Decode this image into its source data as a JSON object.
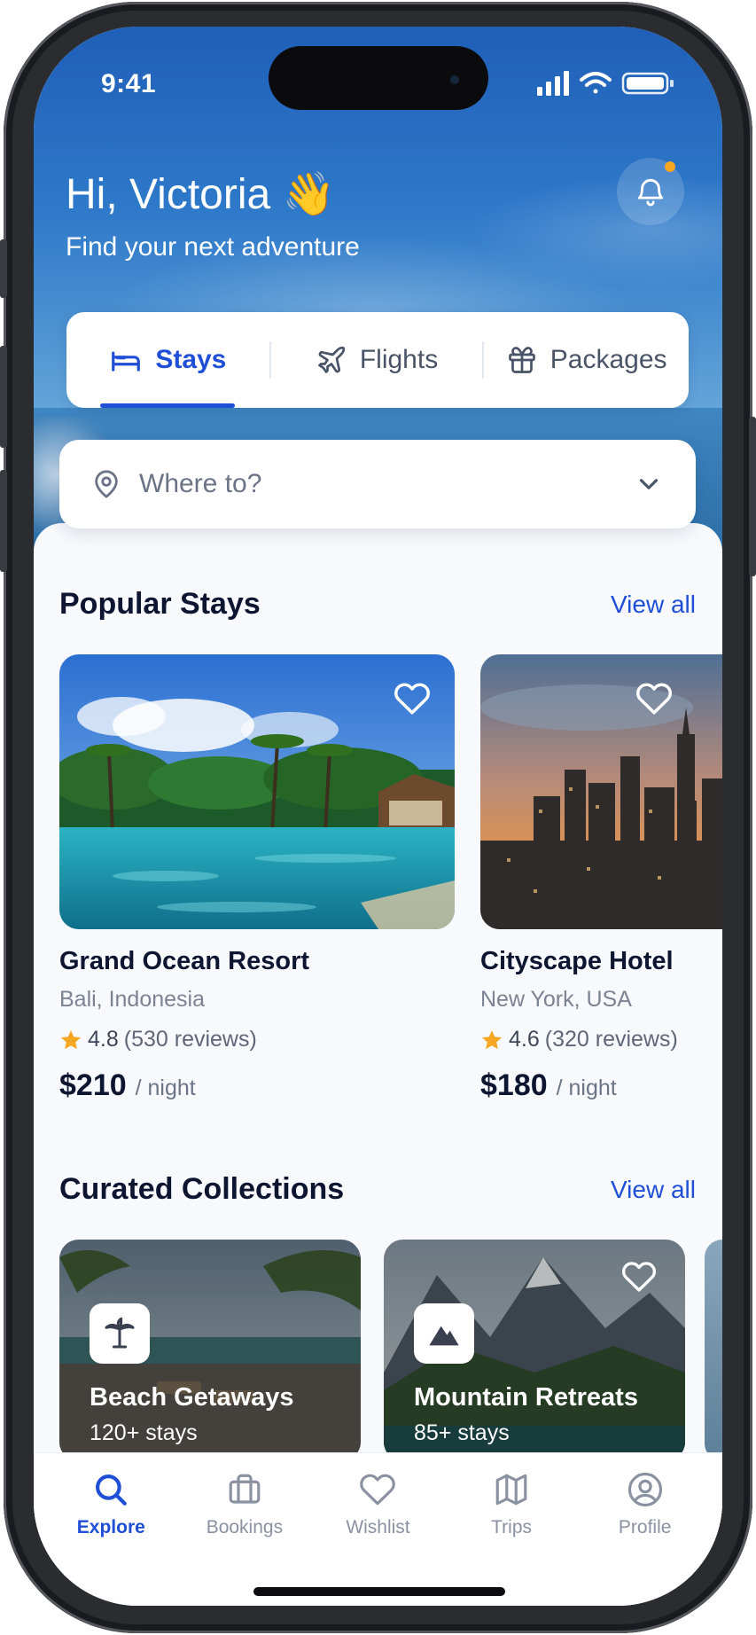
{
  "status_bar": {
    "time": "9:41"
  },
  "header": {
    "greeting": "Hi, Victoria 👋",
    "subtitle": "Find your next adventure",
    "notification_dot_color": "#f5a623"
  },
  "tabs": [
    {
      "label": "Stays",
      "icon": "bed-icon",
      "active": true
    },
    {
      "label": "Flights",
      "icon": "plane-icon",
      "active": false
    },
    {
      "label": "Packages",
      "icon": "gift-icon",
      "active": false
    }
  ],
  "search": {
    "placeholder": "Where to?"
  },
  "popular": {
    "title": "Popular Stays",
    "view_all": "View all",
    "items": [
      {
        "name": "Grand Ocean Resort",
        "location": "Bali, Indonesia",
        "rating": "4.8",
        "reviews": "(530 reviews)",
        "price": "$210",
        "unit": "/ night"
      },
      {
        "name": "Cityscape Hotel",
        "location": "New York, USA",
        "rating": "4.6",
        "reviews": "(320 reviews)",
        "price": "$180",
        "unit": "/ night"
      }
    ]
  },
  "collections": {
    "title": "Curated Collections",
    "view_all": "View all",
    "items": [
      {
        "title": "Beach Getaways",
        "count": "120+ stays",
        "icon": "palm-tree-icon"
      },
      {
        "title": "Mountain Retreats",
        "count": "85+ stays",
        "icon": "mountain-icon"
      }
    ]
  },
  "nav": [
    {
      "label": "Explore",
      "icon": "search-icon",
      "active": true
    },
    {
      "label": "Bookings",
      "icon": "briefcase-icon",
      "active": false
    },
    {
      "label": "Wishlist",
      "icon": "heart-icon",
      "active": false
    },
    {
      "label": "Trips",
      "icon": "map-icon",
      "active": false
    },
    {
      "label": "Profile",
      "icon": "user-circle-icon",
      "active": false
    }
  ],
  "colors": {
    "accent": "#1f4fd6",
    "star": "#f5a623",
    "text_dark": "#0d1530"
  }
}
